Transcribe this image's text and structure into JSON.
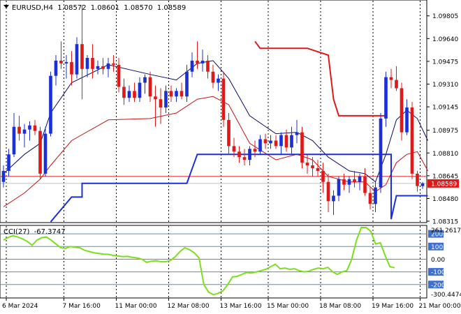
{
  "header": {
    "symbol": "EURUSD,H4",
    "open": "1.08572",
    "high": "1.08601",
    "low": "1.08570",
    "close": "1.08589"
  },
  "indicator": {
    "label": "CCI(27)",
    "value": "-67.3747",
    "axis_max_label": "261.2617",
    "axis_min_label": "-300.4474"
  },
  "colors": {
    "bull": "#1a2fd6",
    "bear": "#e01818",
    "grid": "#000000",
    "upper_band": "#0a0a6e",
    "lower_band": "#c81414",
    "cci": "#7cdf1e",
    "level_line": "#5b8fa8",
    "price_line": "#e01818"
  },
  "chart_data": [
    {
      "type": "candlestick",
      "title": "EURUSD,H4",
      "current_price": 1.08589,
      "ylim": [
        1.0831,
        1.0991
      ],
      "y_ticks": [
        "1.09805",
        "1.09640",
        "1.09475",
        "1.09310",
        "1.09145",
        "1.08975",
        "1.08810",
        "1.08645",
        "1.08480",
        "1.08315"
      ],
      "x_ticks": [
        "6 Mar 2024",
        "7 Mar 16:00",
        "11 Mar 00:00",
        "12 Mar 08:00",
        "13 Mar 16:00",
        "15 Mar 00:00",
        "18 Mar 08:00",
        "19 Mar 16:00",
        "21 Mar 00:00"
      ],
      "candles": [
        {
          "o": 1.086,
          "h": 1.0872,
          "l": 1.0856,
          "c": 1.0868
        },
        {
          "o": 1.0868,
          "h": 1.0884,
          "l": 1.0864,
          "c": 1.088
        },
        {
          "o": 1.088,
          "h": 1.091,
          "l": 1.0878,
          "c": 1.09
        },
        {
          "o": 1.09,
          "h": 1.0908,
          "l": 1.089,
          "c": 1.0895
        },
        {
          "o": 1.0895,
          "h": 1.0902,
          "l": 1.0885,
          "c": 1.0898
        },
        {
          "o": 1.0898,
          "h": 1.0904,
          "l": 1.089,
          "c": 1.0901
        },
        {
          "o": 1.0901,
          "h": 1.0905,
          "l": 1.0894,
          "c": 1.0897
        },
        {
          "o": 1.0897,
          "h": 1.09,
          "l": 1.0862,
          "c": 1.0866
        },
        {
          "o": 1.0866,
          "h": 1.09,
          "l": 1.0864,
          "c": 1.0895
        },
        {
          "o": 1.0895,
          "h": 1.094,
          "l": 1.0893,
          "c": 1.0937
        },
        {
          "o": 1.0937,
          "h": 1.0952,
          "l": 1.093,
          "c": 1.0948
        },
        {
          "o": 1.0948,
          "h": 1.0962,
          "l": 1.0942,
          "c": 1.0946
        },
        {
          "o": 1.0946,
          "h": 1.0952,
          "l": 1.0935,
          "c": 1.0947
        },
        {
          "o": 1.0947,
          "h": 1.0955,
          "l": 1.093,
          "c": 1.0938
        },
        {
          "o": 1.0938,
          "h": 1.0965,
          "l": 1.0935,
          "c": 1.096
        },
        {
          "o": 1.096,
          "h": 1.0988,
          "l": 1.092,
          "c": 1.0942
        },
        {
          "o": 1.0942,
          "h": 1.0952,
          "l": 1.0936,
          "c": 1.095
        },
        {
          "o": 1.095,
          "h": 1.096,
          "l": 1.0935,
          "c": 1.0942
        },
        {
          "o": 1.0942,
          "h": 1.0948,
          "l": 1.0938,
          "c": 1.0944
        },
        {
          "o": 1.0944,
          "h": 1.095,
          "l": 1.0938,
          "c": 1.0942
        },
        {
          "o": 1.0942,
          "h": 1.095,
          "l": 1.0936,
          "c": 1.0946
        },
        {
          "o": 1.0946,
          "h": 1.0952,
          "l": 1.094,
          "c": 1.0945
        },
        {
          "o": 1.0945,
          "h": 1.095,
          "l": 1.0925,
          "c": 1.0929
        },
        {
          "o": 1.0929,
          "h": 1.0935,
          "l": 1.0916,
          "c": 1.0921
        },
        {
          "o": 1.0921,
          "h": 1.093,
          "l": 1.0918,
          "c": 1.0926
        },
        {
          "o": 1.0926,
          "h": 1.0932,
          "l": 1.0918,
          "c": 1.0921
        },
        {
          "o": 1.0921,
          "h": 1.0936,
          "l": 1.0918,
          "c": 1.0932
        },
        {
          "o": 1.0932,
          "h": 1.0938,
          "l": 1.0924,
          "c": 1.0936
        },
        {
          "o": 1.0936,
          "h": 1.094,
          "l": 1.0918,
          "c": 1.0922
        },
        {
          "o": 1.0922,
          "h": 1.093,
          "l": 1.09,
          "c": 1.092
        },
        {
          "o": 1.092,
          "h": 1.0928,
          "l": 1.0902,
          "c": 1.0914
        },
        {
          "o": 1.0914,
          "h": 1.093,
          "l": 1.091,
          "c": 1.0926
        },
        {
          "o": 1.0926,
          "h": 1.093,
          "l": 1.0918,
          "c": 1.0922
        },
        {
          "o": 1.0922,
          "h": 1.0928,
          "l": 1.0918,
          "c": 1.0926
        },
        {
          "o": 1.0926,
          "h": 1.0932,
          "l": 1.092,
          "c": 1.0922
        },
        {
          "o": 1.0922,
          "h": 1.0945,
          "l": 1.0918,
          "c": 1.094
        },
        {
          "o": 1.094,
          "h": 1.0954,
          "l": 1.0936,
          "c": 1.0948
        },
        {
          "o": 1.0948,
          "h": 1.0962,
          "l": 1.0942,
          "c": 1.0946
        },
        {
          "o": 1.0946,
          "h": 1.0956,
          "l": 1.094,
          "c": 1.0948
        },
        {
          "o": 1.0948,
          "h": 1.0952,
          "l": 1.0935,
          "c": 1.094
        },
        {
          "o": 1.094,
          "h": 1.0945,
          "l": 1.0928,
          "c": 1.0932
        },
        {
          "o": 1.0932,
          "h": 1.0938,
          "l": 1.0926,
          "c": 1.0935
        },
        {
          "o": 1.0935,
          "h": 1.094,
          "l": 1.09,
          "c": 1.0905
        },
        {
          "o": 1.0905,
          "h": 1.091,
          "l": 1.088,
          "c": 1.0886
        },
        {
          "o": 1.0886,
          "h": 1.0892,
          "l": 1.0878,
          "c": 1.0882
        },
        {
          "o": 1.0882,
          "h": 1.0886,
          "l": 1.0874,
          "c": 1.0878
        },
        {
          "o": 1.0878,
          "h": 1.0884,
          "l": 1.0872,
          "c": 1.0876
        },
        {
          "o": 1.0876,
          "h": 1.0886,
          "l": 1.0872,
          "c": 1.0884
        },
        {
          "o": 1.0884,
          "h": 1.089,
          "l": 1.0878,
          "c": 1.0882
        },
        {
          "o": 1.0882,
          "h": 1.0894,
          "l": 1.088,
          "c": 1.0891
        },
        {
          "o": 1.0891,
          "h": 1.0895,
          "l": 1.0884,
          "c": 1.0888
        },
        {
          "o": 1.0888,
          "h": 1.0894,
          "l": 1.0884,
          "c": 1.089
        },
        {
          "o": 1.089,
          "h": 1.0894,
          "l": 1.0884,
          "c": 1.0886
        },
        {
          "o": 1.0886,
          "h": 1.0896,
          "l": 1.088,
          "c": 1.0894
        },
        {
          "o": 1.0894,
          "h": 1.0898,
          "l": 1.0882,
          "c": 1.0885
        },
        {
          "o": 1.0885,
          "h": 1.09,
          "l": 1.088,
          "c": 1.0894
        },
        {
          "o": 1.0894,
          "h": 1.0905,
          "l": 1.0888,
          "c": 1.0896
        },
        {
          "o": 1.0896,
          "h": 1.09,
          "l": 1.087,
          "c": 1.0874
        },
        {
          "o": 1.0874,
          "h": 1.088,
          "l": 1.0866,
          "c": 1.0872
        },
        {
          "o": 1.0872,
          "h": 1.0878,
          "l": 1.0864,
          "c": 1.087
        },
        {
          "o": 1.087,
          "h": 1.0876,
          "l": 1.0864,
          "c": 1.0868
        },
        {
          "o": 1.0868,
          "h": 1.0874,
          "l": 1.0852,
          "c": 1.086
        },
        {
          "o": 1.086,
          "h": 1.0866,
          "l": 1.0838,
          "c": 1.0846
        },
        {
          "o": 1.0846,
          "h": 1.0854,
          "l": 1.0836,
          "c": 1.085
        },
        {
          "o": 1.085,
          "h": 1.0864,
          "l": 1.0846,
          "c": 1.0862
        },
        {
          "o": 1.0862,
          "h": 1.0866,
          "l": 1.0854,
          "c": 1.0858
        },
        {
          "o": 1.0858,
          "h": 1.0864,
          "l": 1.0852,
          "c": 1.0862
        },
        {
          "o": 1.0862,
          "h": 1.0868,
          "l": 1.0856,
          "c": 1.086
        },
        {
          "o": 1.086,
          "h": 1.0866,
          "l": 1.0854,
          "c": 1.0864
        },
        {
          "o": 1.0864,
          "h": 1.087,
          "l": 1.085,
          "c": 1.0852
        },
        {
          "o": 1.0852,
          "h": 1.0856,
          "l": 1.084,
          "c": 1.0844
        },
        {
          "o": 1.0844,
          "h": 1.086,
          "l": 1.0838,
          "c": 1.0856
        },
        {
          "o": 1.0856,
          "h": 1.091,
          "l": 1.0852,
          "c": 1.0906
        },
        {
          "o": 1.0906,
          "h": 1.094,
          "l": 1.09,
          "c": 1.0936
        },
        {
          "o": 1.0936,
          "h": 1.0942,
          "l": 1.0928,
          "c": 1.0934
        },
        {
          "o": 1.0934,
          "h": 1.0944,
          "l": 1.0926,
          "c": 1.0928
        },
        {
          "o": 1.0928,
          "h": 1.0932,
          "l": 1.089,
          "c": 1.0896
        },
        {
          "o": 1.0896,
          "h": 1.092,
          "l": 1.0894,
          "c": 1.0914
        },
        {
          "o": 1.0914,
          "h": 1.0918,
          "l": 1.0862,
          "c": 1.0866
        },
        {
          "o": 1.0866,
          "h": 1.0868,
          "l": 1.0853,
          "c": 1.0857
        },
        {
          "o": 1.0857,
          "h": 1.086,
          "l": 1.0855,
          "c": 1.0859
        }
      ],
      "upper_band": [
        [
          0,
          1.0866
        ],
        [
          4,
          1.088
        ],
        [
          7,
          1.0888
        ],
        [
          9,
          1.091
        ],
        [
          13,
          1.0932
        ],
        [
          20,
          1.0945
        ],
        [
          28,
          1.0938
        ],
        [
          33,
          1.0934
        ],
        [
          37,
          1.0946
        ],
        [
          40,
          1.0948
        ],
        [
          43,
          1.0935
        ],
        [
          47,
          1.0908
        ],
        [
          52,
          1.0895
        ],
        [
          56,
          1.0896
        ],
        [
          59,
          1.089
        ],
        [
          62,
          1.0878
        ],
        [
          66,
          1.0868
        ],
        [
          69,
          1.0866
        ],
        [
          71,
          1.086
        ],
        [
          73,
          1.088
        ],
        [
          75,
          1.0905
        ],
        [
          77,
          1.0912
        ],
        [
          79,
          1.0906
        ],
        [
          81,
          1.089
        ]
      ],
      "lower_band": [
        [
          0,
          1.0842
        ],
        [
          4,
          1.0852
        ],
        [
          7,
          1.0862
        ],
        [
          9,
          1.0872
        ],
        [
          13,
          1.089
        ],
        [
          20,
          1.0905
        ],
        [
          28,
          1.0906
        ],
        [
          33,
          1.091
        ],
        [
          37,
          1.092
        ],
        [
          40,
          1.0922
        ],
        [
          43,
          1.0916
        ],
        [
          47,
          1.0888
        ],
        [
          52,
          1.0876
        ],
        [
          56,
          1.088
        ],
        [
          59,
          1.0876
        ],
        [
          62,
          1.0864
        ],
        [
          66,
          1.086
        ],
        [
          69,
          1.086
        ],
        [
          71,
          1.0853
        ],
        [
          73,
          1.0858
        ],
        [
          75,
          1.0874
        ],
        [
          77,
          1.088
        ],
        [
          79,
          1.0882
        ],
        [
          81,
          1.0868
        ]
      ],
      "stop_upper": [
        [
          48,
          1.0962
        ],
        [
          49,
          1.0957
        ],
        [
          58,
          1.0957
        ],
        [
          62,
          1.0952
        ],
        [
          63,
          1.092
        ],
        [
          64,
          1.0908
        ],
        [
          73,
          1.0908
        ]
      ],
      "stop_lower": [
        [
          9,
          1.0831
        ],
        [
          13,
          1.0849
        ],
        [
          15,
          1.0849
        ],
        [
          15,
          1.0859
        ],
        [
          35,
          1.0859
        ],
        [
          37,
          1.088
        ],
        [
          44,
          1.088
        ],
        [
          74,
          1.088
        ],
        [
          74,
          1.0833
        ],
        [
          75,
          1.085
        ],
        [
          81,
          1.085
        ]
      ],
      "hline": 1.0864
    },
    {
      "type": "line",
      "title": "CCI(27)",
      "ylim": [
        -300.4474,
        261.2617
      ],
      "levels": [
        200,
        100,
        0,
        -100,
        -200
      ],
      "level_labels": [
        "200",
        "100",
        "0.00",
        "-100",
        "-200"
      ],
      "values": [
        150,
        172,
        185,
        175,
        160,
        140,
        110,
        150,
        170,
        175,
        150,
        120,
        90,
        85,
        100,
        95,
        90,
        70,
        60,
        50,
        45,
        40,
        38,
        30,
        25,
        20,
        22,
        15,
        10,
        0,
        -25,
        -15,
        -12,
        -20,
        -20,
        -10,
        20,
        60,
        90,
        75,
        50,
        10,
        -200,
        -260,
        -280,
        -270,
        -250,
        -200,
        -140,
        -135,
        -120,
        -105,
        -110,
        -100,
        -90,
        -80,
        -60,
        -40,
        -75,
        -70,
        -80,
        -75,
        -90,
        -100,
        -95,
        -80,
        -70,
        -75,
        -65,
        -100,
        -120,
        -100,
        -90,
        0,
        150,
        250,
        250,
        220,
        120,
        130,
        30,
        -60,
        -67.3747
      ]
    }
  ]
}
